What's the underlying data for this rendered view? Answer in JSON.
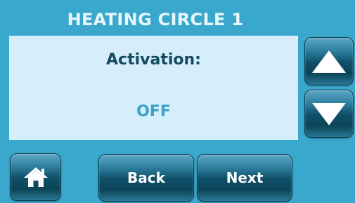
{
  "screen": {
    "title": "HEATING CIRCLE 1",
    "background_color": "#3aa8cd"
  },
  "panel": {
    "label": "Activation:",
    "value": "OFF",
    "label_color": "#124a60",
    "value_color": "#3aa3c7"
  },
  "controls": {
    "up_icon": "up-arrow-icon",
    "down_icon": "down-arrow-icon",
    "home_icon": "home-icon",
    "back_label": "Back",
    "next_label": "Next"
  }
}
